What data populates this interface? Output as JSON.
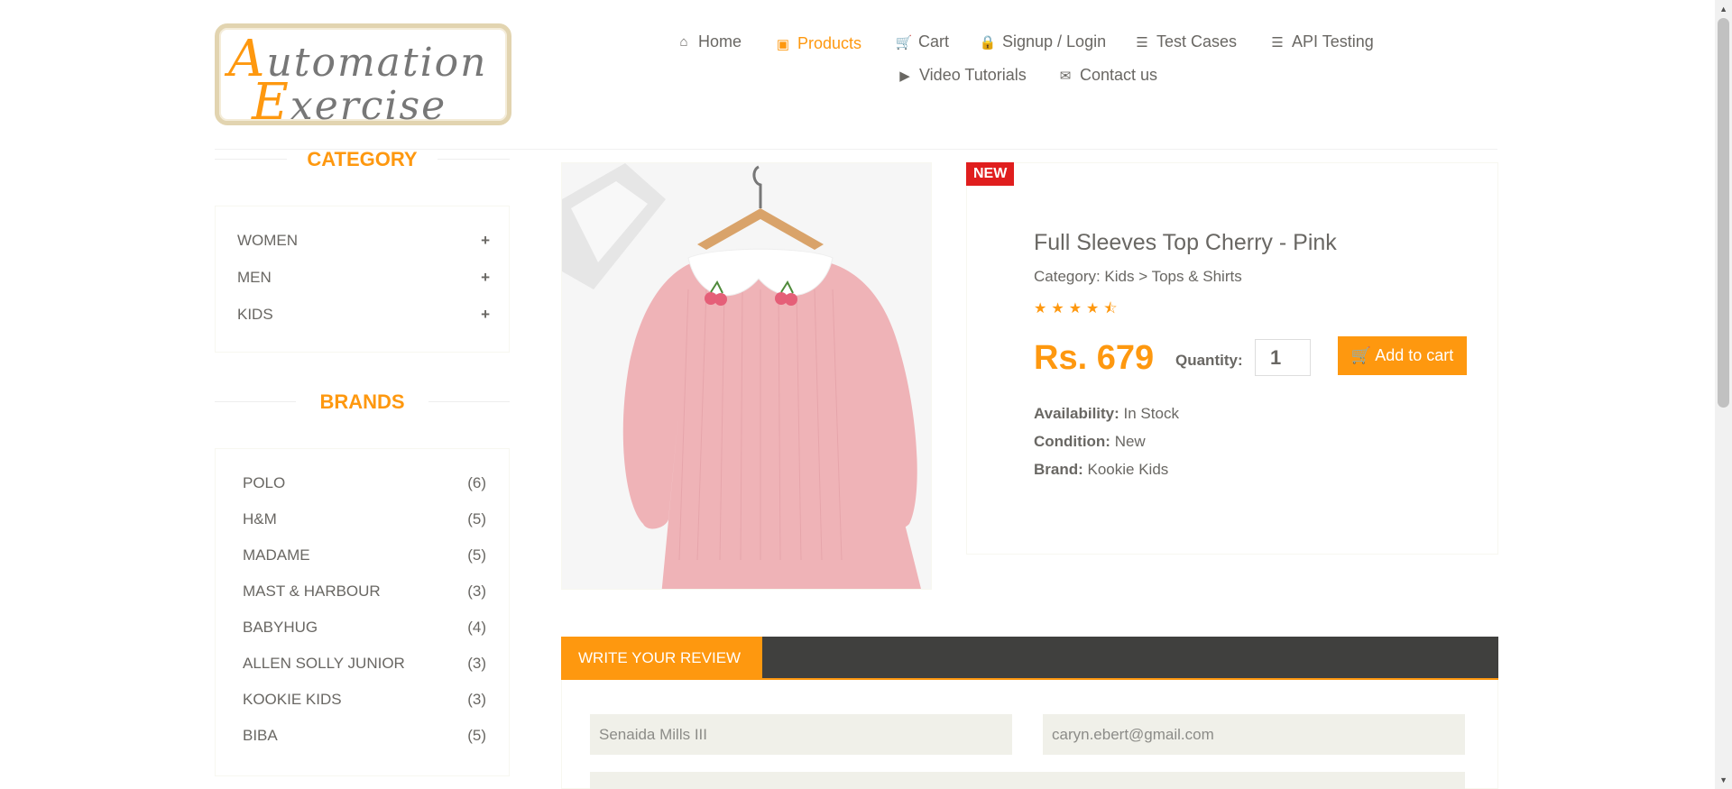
{
  "logo": {
    "line1": "utomation",
    "line1_cap": "A",
    "line2": "xercise",
    "line2_cap": "E",
    "alt": "Automation Exercise"
  },
  "nav": [
    {
      "label": "Home",
      "icon": "home-icon",
      "glyph": "⌂"
    },
    {
      "label": "Products",
      "icon": "products-icon",
      "glyph": "▣"
    },
    {
      "label": "Cart",
      "icon": "cart-icon",
      "glyph": "🛒"
    },
    {
      "label": "Signup / Login",
      "icon": "lock-icon",
      "glyph": "🔒"
    },
    {
      "label": "Test Cases",
      "icon": "list-icon",
      "glyph": "☰"
    },
    {
      "label": "API Testing",
      "icon": "list-icon",
      "glyph": "☰"
    },
    {
      "label": "Video Tutorials",
      "icon": "youtube-icon",
      "glyph": "▶"
    },
    {
      "label": "Contact us",
      "icon": "envelope-icon",
      "glyph": "✉"
    }
  ],
  "active_nav": "Products",
  "sidebar": {
    "category_title": "CATEGORY",
    "categories": [
      "WOMEN",
      "MEN",
      "KIDS"
    ],
    "brands_title": "BRANDS",
    "brands": [
      {
        "name": "POLO",
        "count": "(6)"
      },
      {
        "name": "H&M",
        "count": "(5)"
      },
      {
        "name": "MADAME",
        "count": "(5)"
      },
      {
        "name": "MAST & HARBOUR",
        "count": "(3)"
      },
      {
        "name": "BABYHUG",
        "count": "(4)"
      },
      {
        "name": "ALLEN SOLLY JUNIOR",
        "count": "(3)"
      },
      {
        "name": "KOOKIE KIDS",
        "count": "(3)"
      },
      {
        "name": "BIBA",
        "count": "(5)"
      }
    ]
  },
  "product": {
    "badge": "NEW",
    "title": "Full Sleeves Top Cherry - Pink",
    "category": "Category: Kids > Tops & Shirts",
    "rating": 4.5,
    "price": "Rs. 679",
    "quantity_label": "Quantity:",
    "quantity": "1",
    "add_to_cart": "Add to cart",
    "availability_label": "Availability:",
    "availability": "In Stock",
    "condition_label": "Condition:",
    "condition": "New",
    "brand_label": "Brand:",
    "brand": "Kookie Kids"
  },
  "review": {
    "tab_label": "WRITE YOUR REVIEW",
    "name_value": "Senaida Mills III",
    "email_value": "caryn.ebert@gmail.com"
  },
  "colors": {
    "accent": "#FE980F",
    "dark_bar": "#40403E",
    "badge_red": "#E01E1E",
    "text": "#696763"
  }
}
